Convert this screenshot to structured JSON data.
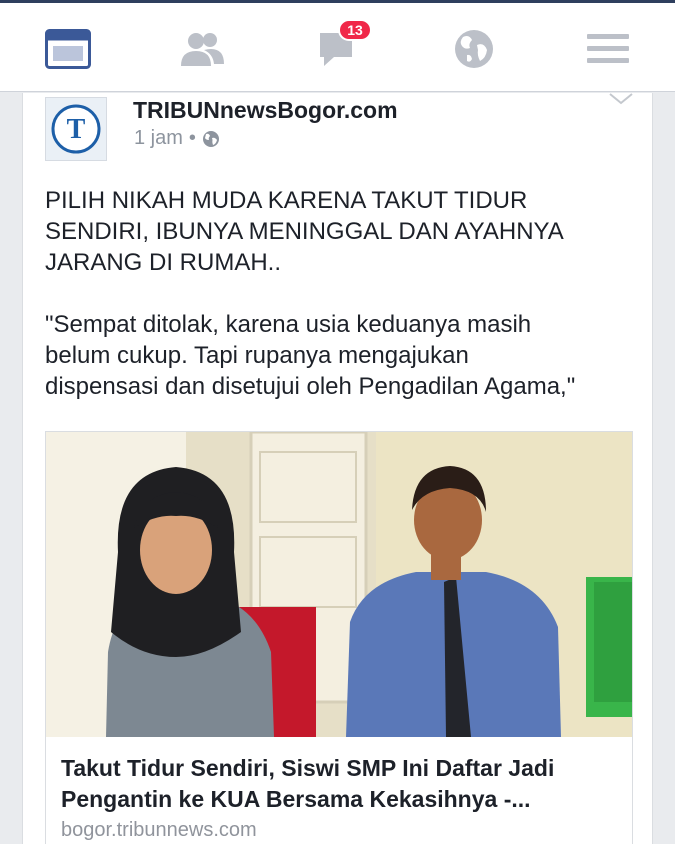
{
  "nav": {
    "items": [
      "home",
      "friends",
      "messages",
      "globe",
      "menu"
    ],
    "messages_badge": "13",
    "colors": {
      "active": "#3b5998",
      "inactive": "#bcc0c8",
      "badge": "#f02849"
    }
  },
  "post": {
    "page_name": "TRIBUNnewsBogor.com",
    "time": "1 jam",
    "separator": "•",
    "privacy_icon": "globe-icon",
    "avatar_letter": "T",
    "text": [
      "PILIH NIKAH MUDA KARENA TAKUT TIDUR\nSENDIRI, IBUNYA MENINGGAL DAN AYAHNYA\nJARANG DI RUMAH..",
      "\"Sempat ditolak, karena usia keduanya masih\nbelum cukup. Tapi rupanya mengajukan\ndispensasi dan disetujui oleh Pengadilan Agama,\""
    ],
    "link": {
      "title": "Takut Tidur Sendiri, Siswi SMP Ini Daftar Jadi Pengantin ke KUA Bersama Kekasihnya -...",
      "domain": "bogor.tribunnews.com"
    }
  }
}
